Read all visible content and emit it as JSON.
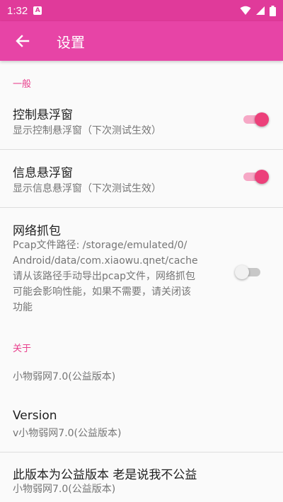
{
  "status_bar": {
    "time": "1:32",
    "notif_glyph": "A",
    "icons": [
      "wifi-icon",
      "signal-icon",
      "battery-icon"
    ]
  },
  "app_bar": {
    "title": "设置",
    "back_icon": "arrow-left-icon"
  },
  "colors": {
    "status_bar": "#e03a9a",
    "app_bar": "#e744a6",
    "accent": "#ec407a"
  },
  "sections": {
    "general": {
      "header": "一般"
    },
    "about": {
      "header": "关于"
    }
  },
  "prefs": {
    "control_float": {
      "title": "控制悬浮窗",
      "summary": "显示控制悬浮窗（下次测试生效）",
      "enabled": true
    },
    "info_float": {
      "title": "信息悬浮窗",
      "summary": "显示信息悬浮窗（下次测试生效）",
      "enabled": true
    },
    "packet_capture": {
      "title": "网络抓包",
      "summary_lines": [
        "Pcap文件路径: /storage/emulated/0/",
        "Android/data/com.xiaowu.qnet/cache",
        "请从该路径手动导出pcap文件，网络抓包",
        "可能会影响性能，如果不需要，请关闭该",
        "功能"
      ],
      "enabled": false
    }
  },
  "about_items": {
    "name": "小物弱网7.0(公益版本)",
    "version": {
      "title": "Version",
      "value": "v小物弱网7.0(公益版本)"
    },
    "charity": {
      "title": "此版本为公益版本 老是说我不公益",
      "value": "小物弱网7.0(公益版本)"
    }
  }
}
